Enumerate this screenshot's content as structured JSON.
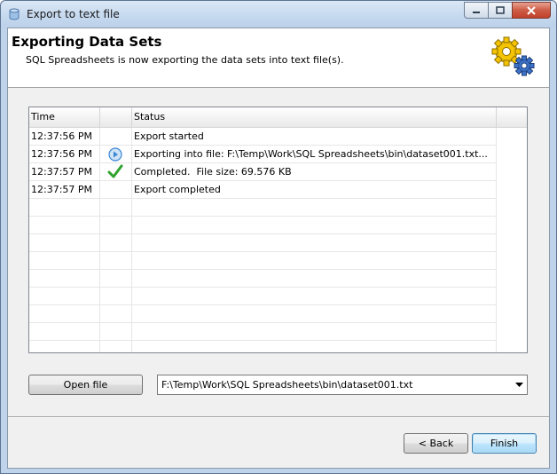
{
  "window": {
    "title": "Export to text file"
  },
  "header": {
    "title": "Exporting Data Sets",
    "subtitle": "SQL Spreadsheets is now exporting the data sets into text file(s)."
  },
  "log": {
    "columns": [
      "Time",
      "",
      "Status"
    ],
    "rows": [
      {
        "time": "12:37:56 PM",
        "icon": "",
        "status": "Export started"
      },
      {
        "time": "12:37:56 PM",
        "icon": "play-circle-icon",
        "status": "Exporting into file: F:\\Temp\\Work\\SQL Spreadsheets\\bin\\dataset001.txt..."
      },
      {
        "time": "12:37:57 PM",
        "icon": "checkmark-icon",
        "status": "Completed.  File size: 69.576 KB"
      },
      {
        "time": "12:37:57 PM",
        "icon": "",
        "status": "Export completed"
      }
    ]
  },
  "file": {
    "open_label": "Open file",
    "selected": "F:\\Temp\\Work\\SQL Spreadsheets\\bin\\dataset001.txt"
  },
  "buttons": {
    "back_label": "< Back",
    "finish_label": "Finish"
  },
  "colors": {
    "accent": "#3c7fb1",
    "check": "#2fa32f",
    "info": "#3a86d4",
    "gear_yellow": "#f5c400",
    "gear_blue": "#3c72c8"
  }
}
